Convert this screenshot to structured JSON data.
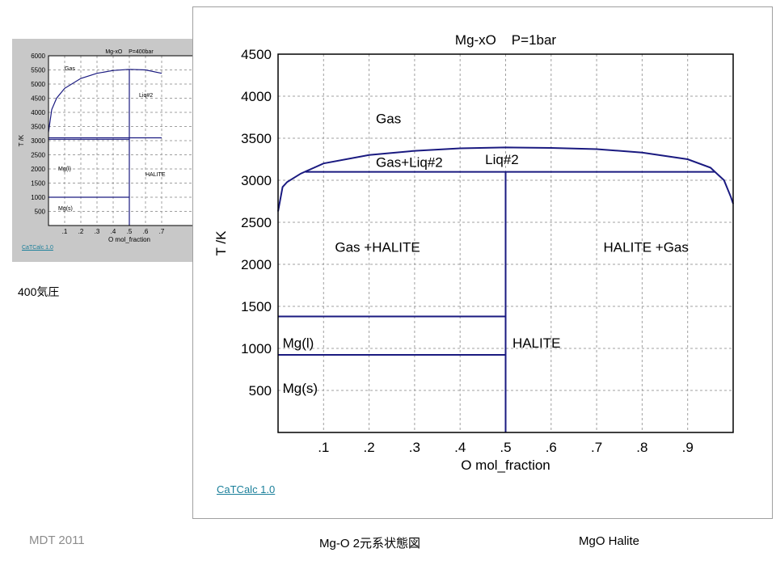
{
  "thumbnail": {
    "link_text": "CaTCalc 1.0",
    "caption": "400気圧",
    "chart_data": {
      "type": "line",
      "title": "Mg-xO    P=400bar",
      "xlabel": "O mol_fraction",
      "ylabel": "T /K",
      "xlim": [
        0,
        1
      ],
      "ylim": [
        0,
        6000
      ],
      "x_ticks": [
        ".1",
        ".2",
        ".3",
        ".4",
        ".5",
        ".6",
        ".7"
      ],
      "y_ticks": [
        "500",
        "1000",
        "1500",
        "2000",
        "2500",
        "3000",
        "3500",
        "4000",
        "4500",
        "5000",
        "5500",
        "6000"
      ],
      "grid": true,
      "series": [
        {
          "values": [
            [
              0,
              3300
            ],
            [
              0.02,
              4100
            ],
            [
              0.05,
              4500
            ],
            [
              0.1,
              4850
            ],
            [
              0.2,
              5200
            ],
            [
              0.3,
              5380
            ],
            [
              0.4,
              5480
            ],
            [
              0.5,
              5520
            ],
            [
              0.6,
              5500
            ],
            [
              0.7,
              5380
            ]
          ]
        },
        {
          "values": [
            [
              0,
              3100
            ],
            [
              0.7,
              3100
            ]
          ]
        },
        {
          "values": [
            [
              0,
              3050
            ],
            [
              0.5,
              3050
            ]
          ]
        },
        {
          "values": [
            [
              0,
              1000
            ],
            [
              0.5,
              1000
            ]
          ]
        },
        {
          "values": [
            [
              0.5,
              0
            ],
            [
              0.5,
              5520
            ]
          ]
        }
      ],
      "region_labels": [
        {
          "text": "Gas",
          "x": 0.1,
          "y": 5480
        },
        {
          "text": "Liq#2",
          "x": 0.56,
          "y": 4550
        },
        {
          "text": "Mg(l)",
          "x": 0.06,
          "y": 1950
        },
        {
          "text": "HALITE",
          "x": 0.6,
          "y": 1750
        },
        {
          "text": "Mg(s)",
          "x": 0.06,
          "y": 550
        }
      ]
    }
  },
  "main": {
    "link_text": "CaTCalc 1.0",
    "chart_data": {
      "type": "line",
      "title": "Mg-xO    P=1bar",
      "xlabel": "O mol_fraction",
      "ylabel": "T /K",
      "xlim": [
        0,
        1
      ],
      "ylim": [
        0,
        4500
      ],
      "x_ticks": [
        ".1",
        ".2",
        ".3",
        ".4",
        ".5",
        ".6",
        ".7",
        ".8",
        ".9"
      ],
      "y_ticks": [
        "500",
        "1000",
        "1500",
        "2000",
        "2500",
        "3000",
        "3500",
        "4000",
        "4500"
      ],
      "grid": true,
      "series": [
        {
          "values": [
            [
              0,
              2630
            ],
            [
              0.01,
              2920
            ],
            [
              0.02,
              2980
            ],
            [
              0.05,
              3080
            ],
            [
              0.1,
              3200
            ],
            [
              0.2,
              3300
            ],
            [
              0.3,
              3350
            ],
            [
              0.4,
              3380
            ],
            [
              0.5,
              3390
            ],
            [
              0.6,
              3385
            ],
            [
              0.7,
              3370
            ],
            [
              0.8,
              3330
            ],
            [
              0.9,
              3250
            ],
            [
              0.95,
              3150
            ],
            [
              0.98,
              3000
            ],
            [
              0.995,
              2800
            ],
            [
              1,
              2720
            ]
          ]
        },
        {
          "values": [
            [
              0.06,
              3100
            ],
            [
              0.96,
              3100
            ]
          ]
        },
        {
          "values": [
            [
              0,
              1380
            ],
            [
              0.5,
              1380
            ]
          ]
        },
        {
          "values": [
            [
              0,
              923
            ],
            [
              0.5,
              923
            ]
          ]
        },
        {
          "values": [
            [
              0.5,
              0
            ],
            [
              0.5,
              3100
            ]
          ]
        }
      ],
      "region_labels": [
        {
          "text": "Gas",
          "x": 0.215,
          "y": 3680
        },
        {
          "text": "Gas+Liq#2",
          "x": 0.215,
          "y": 3160
        },
        {
          "text": "Liq#2",
          "x": 0.455,
          "y": 3190
        },
        {
          "text": "Gas +HALITE",
          "x": 0.125,
          "y": 2150
        },
        {
          "text": "HALITE +Gas",
          "x": 0.715,
          "y": 2150
        },
        {
          "text": "Mg(l)",
          "x": 0.01,
          "y": 1010
        },
        {
          "text": "HALITE",
          "x": 0.515,
          "y": 1010
        },
        {
          "text": "Mg(s)",
          "x": 0.01,
          "y": 470
        }
      ]
    }
  },
  "footer": {
    "left": "MDT   2011",
    "center": "Mg-O 2元系状態図",
    "right": "MgO    Halite"
  }
}
